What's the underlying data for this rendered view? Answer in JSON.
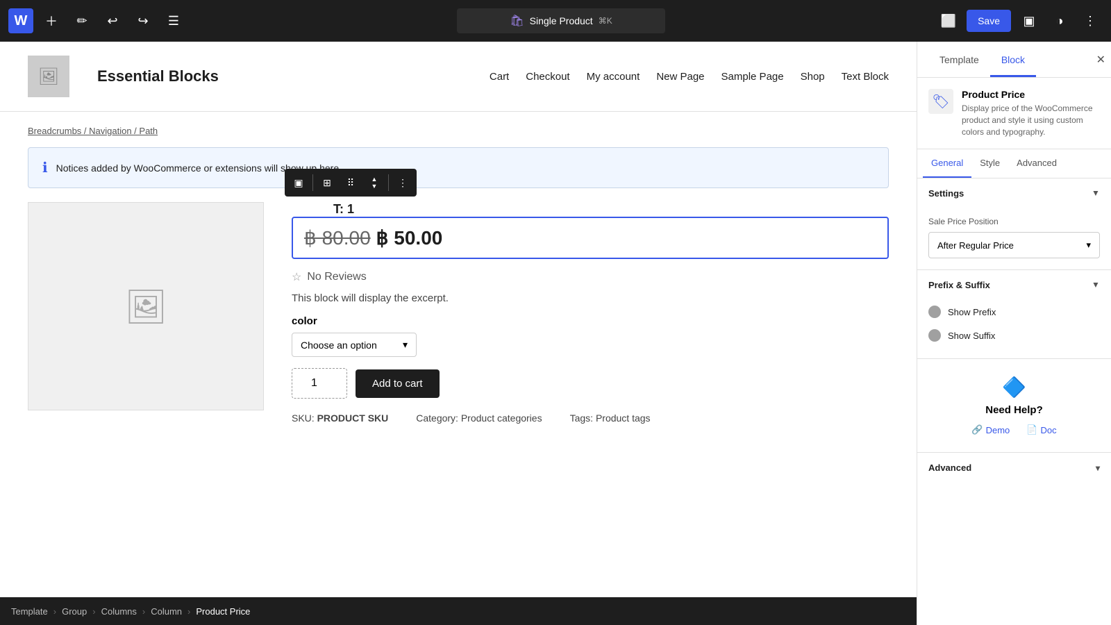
{
  "topbar": {
    "logo": "W",
    "page_title": "Single Product",
    "shortcut": "⌘K",
    "save_label": "Save"
  },
  "site": {
    "logo_alt": "logo",
    "name": "Essential Blocks",
    "nav": [
      "Cart",
      "Checkout",
      "My account",
      "New Page",
      "Sample Page",
      "Shop",
      "Text Block"
    ]
  },
  "breadcrumb": "Breadcrumbs / Navigation / Path",
  "notice": "Notices added by WooCommerce or extensions will show up here.",
  "product": {
    "price_regular": "฿ 80.00",
    "price_sale": "฿ 50.00",
    "reviews": "No Reviews",
    "excerpt": "This block will display the excerpt.",
    "color_label": "color",
    "color_placeholder": "Choose an option",
    "qty": "1",
    "add_to_cart": "Add to cart",
    "sku_label": "SKU:",
    "sku_value": "PRODUCT SKU",
    "category_label": "Category:",
    "category_value": "Product categories",
    "tags_label": "Tags:",
    "tags_value": "Product tags"
  },
  "block_toolbar": {
    "title": "T: 1"
  },
  "bottom_breadcrumb": {
    "items": [
      "Template",
      "Group",
      "Columns",
      "Column",
      "Product Price"
    ],
    "separator": "›"
  },
  "panel": {
    "tabs": [
      "Template",
      "Block"
    ],
    "active_tab": "Block",
    "close_label": "✕",
    "block_icon": "🏷️",
    "block_title": "Product Price",
    "block_desc": "Display price of the WooCommerce product and style it using custom colors and typography.",
    "inner_tabs": [
      "General",
      "Style",
      "Advanced"
    ],
    "active_inner_tab": "General",
    "settings_section": {
      "label": "Settings",
      "open": true
    },
    "sale_price_position": {
      "label": "Sale Price Position",
      "value": "After Regular Price"
    },
    "prefix_suffix": {
      "label": "Prefix & Suffix",
      "open": true,
      "show_prefix": "Show Prefix",
      "show_suffix": "Show Suffix"
    },
    "help": {
      "title": "Need Help?",
      "demo_label": "Demo",
      "doc_label": "Doc"
    },
    "advanced": {
      "label": "Advanced"
    }
  }
}
